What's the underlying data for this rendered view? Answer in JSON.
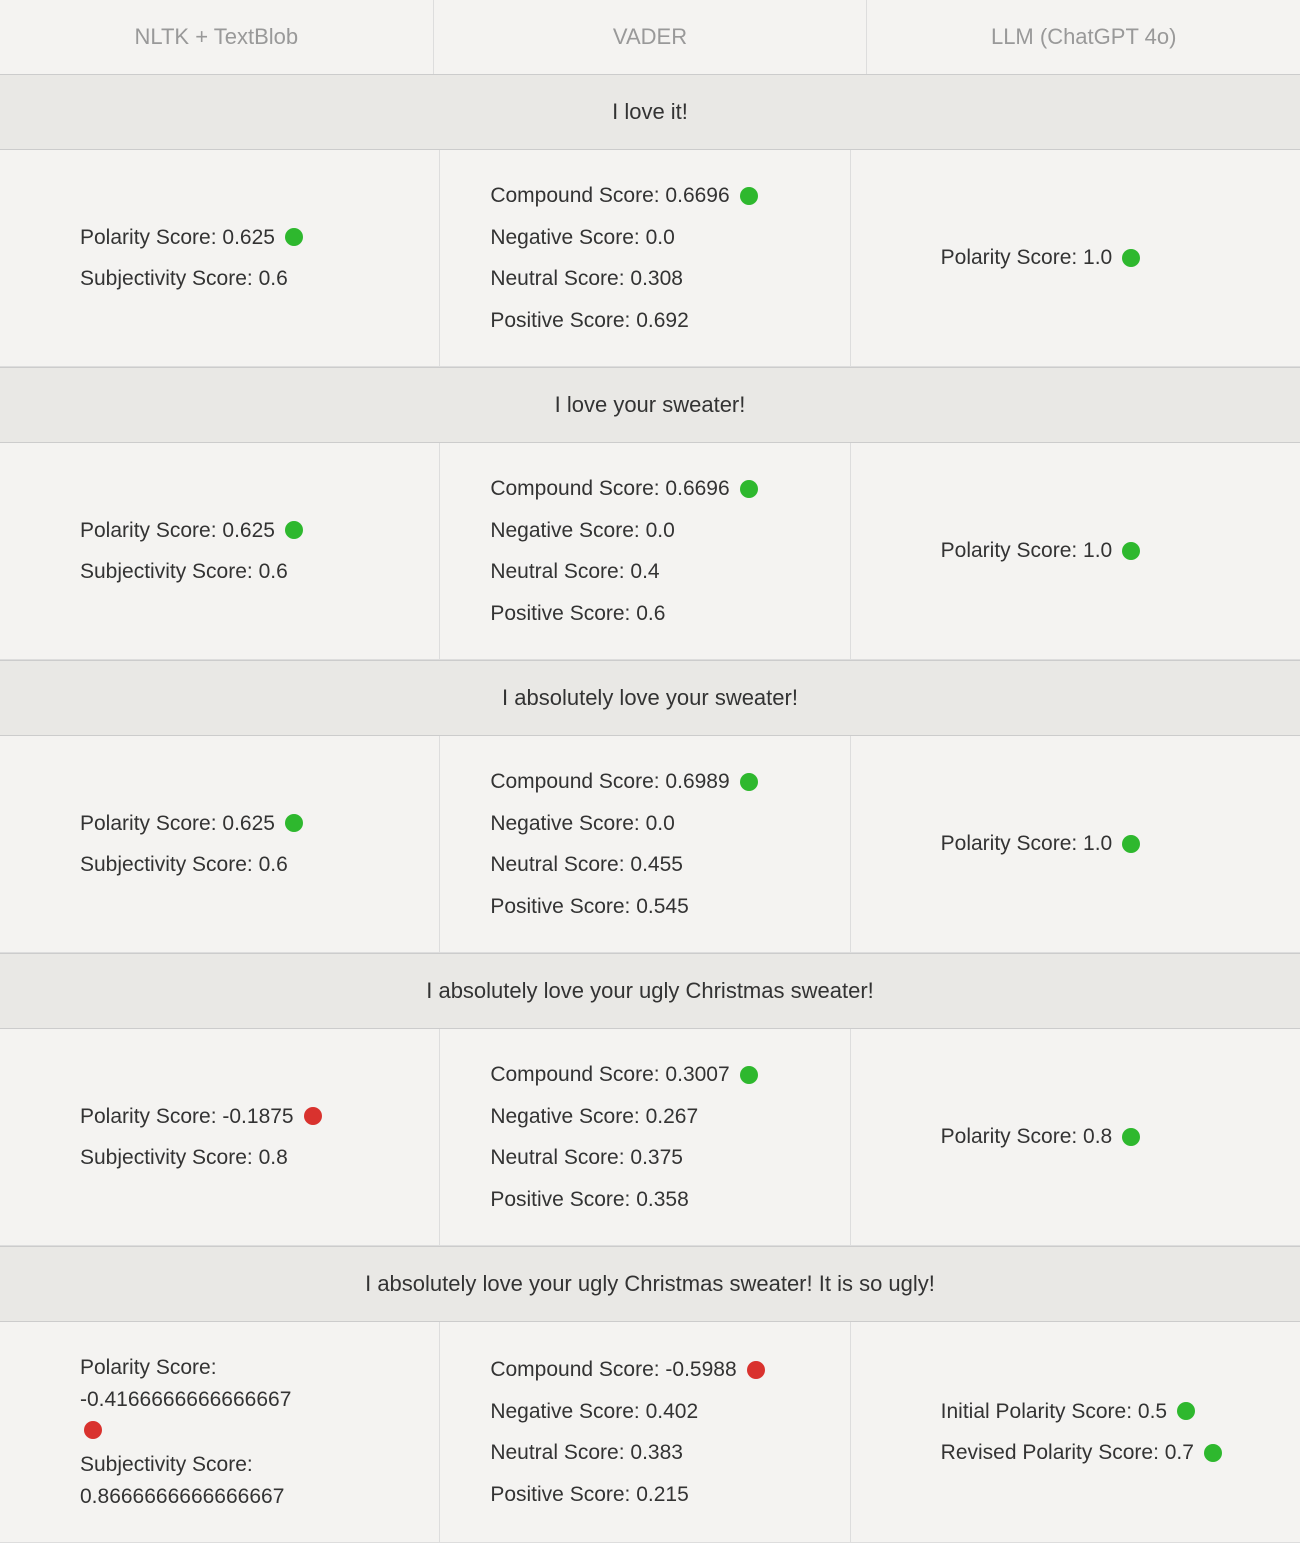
{
  "headers": [
    "NLTK + TextBlob",
    "VADER",
    "LLM (ChatGPT 4o)"
  ],
  "rows": [
    {
      "sentence": "I love it!",
      "nltk": {
        "polarity_label": "Polarity Score: 0.625",
        "polarity_dot": "green",
        "subjectivity_label": "Subjectivity Score: 0.6"
      },
      "vader": {
        "compound_label": "Compound Score: 0.6696",
        "compound_dot": "green",
        "negative_label": "Negative Score: 0.0",
        "neutral_label": "Neutral Score: 0.308",
        "positive_label": "Positive Score: 0.692"
      },
      "llm": [
        {
          "label": "Polarity Score: 1.0",
          "dot": "green"
        }
      ]
    },
    {
      "sentence": "I love your sweater!",
      "nltk": {
        "polarity_label": "Polarity Score: 0.625",
        "polarity_dot": "green",
        "subjectivity_label": "Subjectivity Score: 0.6"
      },
      "vader": {
        "compound_label": "Compound Score: 0.6696",
        "compound_dot": "green",
        "negative_label": "Negative Score: 0.0",
        "neutral_label": "Neutral Score: 0.4",
        "positive_label": "Positive Score: 0.6"
      },
      "llm": [
        {
          "label": "Polarity Score: 1.0",
          "dot": "green"
        }
      ]
    },
    {
      "sentence": "I absolutely love your sweater!",
      "nltk": {
        "polarity_label": "Polarity Score: 0.625",
        "polarity_dot": "green",
        "subjectivity_label": "Subjectivity Score: 0.6"
      },
      "vader": {
        "compound_label": "Compound Score: 0.6989",
        "compound_dot": "green",
        "negative_label": "Negative Score: 0.0",
        "neutral_label": "Neutral Score: 0.455",
        "positive_label": "Positive Score: 0.545"
      },
      "llm": [
        {
          "label": "Polarity Score: 1.0",
          "dot": "green"
        }
      ]
    },
    {
      "sentence": "I absolutely love your ugly Christmas sweater!",
      "nltk": {
        "polarity_label": "Polarity Score: -0.1875",
        "polarity_dot": "red",
        "subjectivity_label": "Subjectivity Score: 0.8"
      },
      "vader": {
        "compound_label": "Compound Score: 0.3007",
        "compound_dot": "green",
        "negative_label": "Negative Score: 0.267",
        "neutral_label": "Neutral Score: 0.375",
        "positive_label": "Positive Score: 0.358"
      },
      "llm": [
        {
          "label": "Polarity Score: 0.8",
          "dot": "green"
        }
      ]
    },
    {
      "sentence": "I absolutely love your ugly Christmas sweater! It is so ugly!",
      "nltk": {
        "polarity_label": "Polarity Score: -0.4166666666666667",
        "polarity_dot": "red",
        "subjectivity_label": "Subjectivity Score: 0.8666666666666667"
      },
      "vader": {
        "compound_label": "Compound Score: -0.5988",
        "compound_dot": "red",
        "negative_label": "Negative Score: 0.402",
        "neutral_label": "Neutral Score: 0.383",
        "positive_label": "Positive Score: 0.215"
      },
      "llm": [
        {
          "label": "Initial Polarity Score: 0.5",
          "dot": "green"
        },
        {
          "label": "Revised Polarity Score: 0.7",
          "dot": "green"
        }
      ]
    }
  ]
}
